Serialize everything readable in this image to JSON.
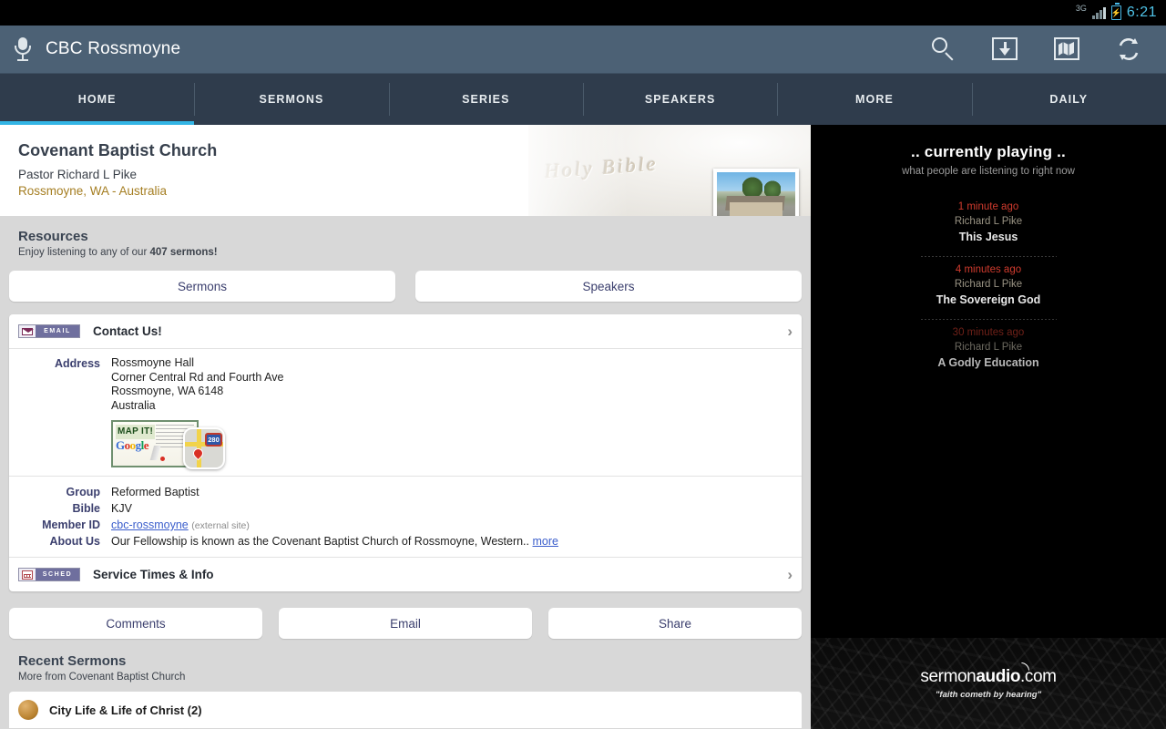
{
  "statusbar": {
    "network": "3G",
    "battery_icon": "battery-charging-icon",
    "time": "6:21"
  },
  "actionbar": {
    "mic_icon": "microphone-icon",
    "title": "CBC Rossmoyne",
    "icons": [
      {
        "name": "search-icon",
        "label": "Search"
      },
      {
        "name": "download-icon",
        "label": "Downloads"
      },
      {
        "name": "map-icon",
        "label": "Map"
      },
      {
        "name": "refresh-icon",
        "label": "Refresh"
      }
    ]
  },
  "tabs": [
    {
      "label": "HOME",
      "selected": true
    },
    {
      "label": "SERMONS",
      "selected": false
    },
    {
      "label": "SERIES",
      "selected": false
    },
    {
      "label": "SPEAKERS",
      "selected": false
    },
    {
      "label": "MORE",
      "selected": false
    },
    {
      "label": "DAILY",
      "selected": false
    }
  ],
  "hero": {
    "church": "Covenant Baptist Church",
    "pastor": "Pastor Richard L Pike",
    "location": "Rossmoyne, WA - Australia",
    "banner_text": "Holy Bible",
    "photo_name": "church-building-photo"
  },
  "resources": {
    "title": "Resources",
    "subtitle_prefix": "Enjoy listening to any of our ",
    "subtitle_count": "407 sermons!",
    "buttons": [
      {
        "label": "Sermons"
      },
      {
        "label": "Speakers"
      }
    ]
  },
  "contact": {
    "badge": "EMAIL",
    "title": "Contact Us!",
    "address_label": "Address",
    "address_lines": [
      "Rossmoyne Hall",
      "Corner Central Rd and Fourth Ave",
      "Rossmoyne, WA 6148",
      "Australia"
    ],
    "mapit": {
      "label": "MAP IT!",
      "brand": "Google",
      "highway": "280"
    }
  },
  "details": [
    {
      "key": "Group",
      "value": "Reformed Baptist"
    },
    {
      "key": "Bible",
      "value": "KJV"
    }
  ],
  "member": {
    "key": "Member ID",
    "link": "cbc-rossmoyne",
    "note": "(external site)"
  },
  "about": {
    "key": "About Us",
    "text": "Our Fellowship is known as the Covenant Baptist Church of Rossmoyne, Western..",
    "more": "more"
  },
  "service": {
    "badge": "SCHED",
    "title": "Service Times & Info"
  },
  "action_buttons": [
    {
      "label": "Comments"
    },
    {
      "label": "Email"
    },
    {
      "label": "Share"
    }
  ],
  "recent": {
    "title": "Recent Sermons",
    "subtitle": "More from Covenant Baptist Church",
    "items": [
      {
        "title": "City Life & Life of Christ (2)"
      }
    ]
  },
  "now_playing": {
    "title": ".. currently playing ..",
    "subtitle": "what people are listening to right now",
    "items": [
      {
        "ago": "1 minute ago",
        "speaker": "Richard L Pike",
        "title": "This Jesus",
        "faded": false
      },
      {
        "ago": "4 minutes ago",
        "speaker": "Richard L Pike",
        "title": "The Sovereign God",
        "faded": false
      },
      {
        "ago": "30 minutes ago",
        "speaker": "Richard L Pike",
        "title": "A Godly Education",
        "faded": true
      }
    ]
  },
  "branding": {
    "line1_a": "sermon",
    "line1_b": "audio",
    "line1_c": ".com",
    "tagline": "\"faith cometh by hearing\""
  },
  "colors": {
    "accent": "#33b5e5",
    "actionbar": "#4c6175",
    "tabbar": "#2f3c4c",
    "location": "#a57e22",
    "link": "#3b5ecc",
    "now_playing_ago": "#d13b2e"
  }
}
